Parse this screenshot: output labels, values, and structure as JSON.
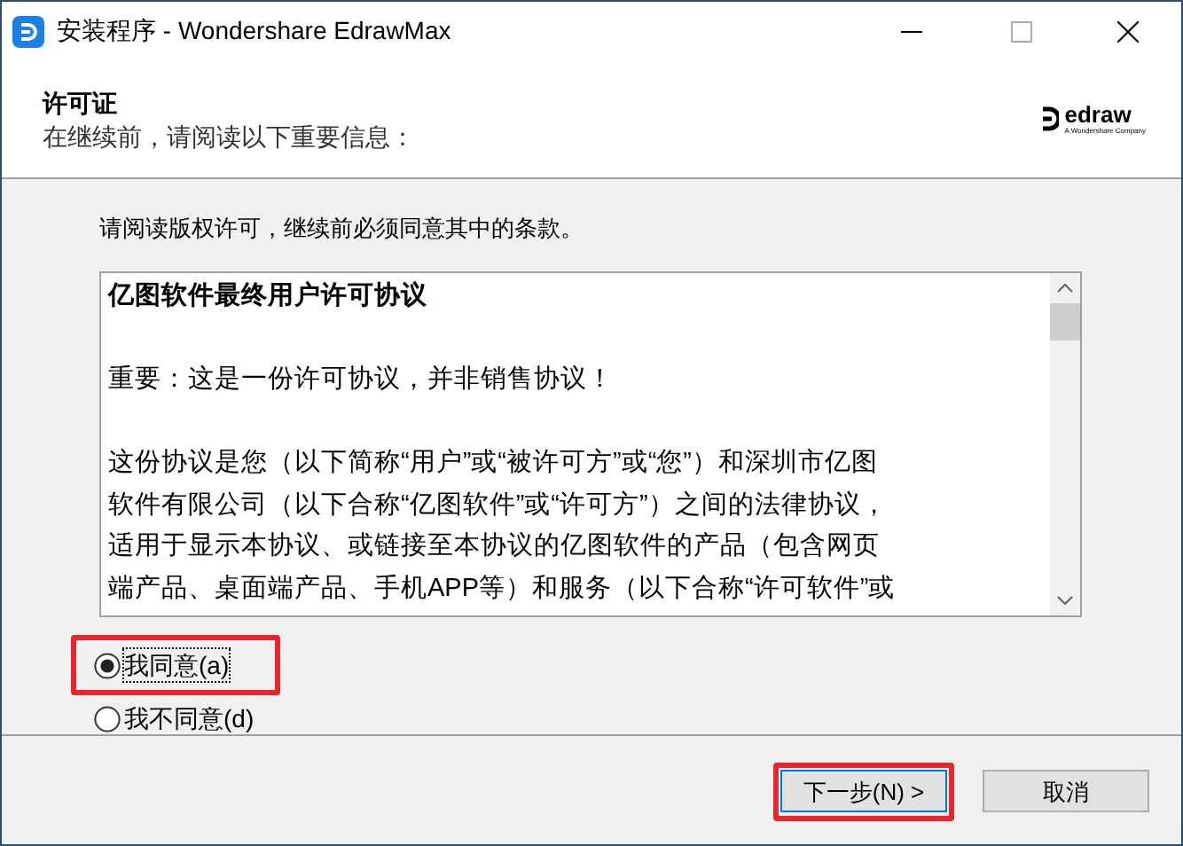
{
  "window": {
    "title": "安装程序 - Wondershare EdrawMax"
  },
  "header": {
    "title": "许可证",
    "subtitle": "在继续前，请阅读以下重要信息：",
    "logo_text": "edraw",
    "logo_tagline": "A Wondershare Company"
  },
  "instruction": "请阅读版权许可，继续前必须同意其中的条款。",
  "license": {
    "paragraphs": [
      {
        "kind": "heading",
        "lines": [
          "亿图软件最终用户许可协议"
        ]
      },
      {
        "kind": "text",
        "lines": [
          "重要：这是一份许可协议，并非销售协议！"
        ]
      },
      {
        "kind": "text",
        "lines": [
          "这份协议是您（以下简称“用户”或“被许可方”或“您”）和深圳市亿图",
          "软件有限公司（以下合称“亿图软件”或“许可方”）之间的法律协议，",
          "适用于显示本协议、或链接至本协议的亿图软件的产品（包含网页",
          "端产品、桌面端产品、手机APP等）和服务（以下合称“许可软件”或"
        ]
      }
    ]
  },
  "options": [
    {
      "label": "我同意(a)",
      "selected": true,
      "highlighted": true
    },
    {
      "label": "我不同意(d)",
      "selected": false,
      "highlighted": false
    }
  ],
  "buttons": [
    {
      "label": "下一步(N) >",
      "highlighted": true
    },
    {
      "label": "取消",
      "highlighted": false
    }
  ]
}
